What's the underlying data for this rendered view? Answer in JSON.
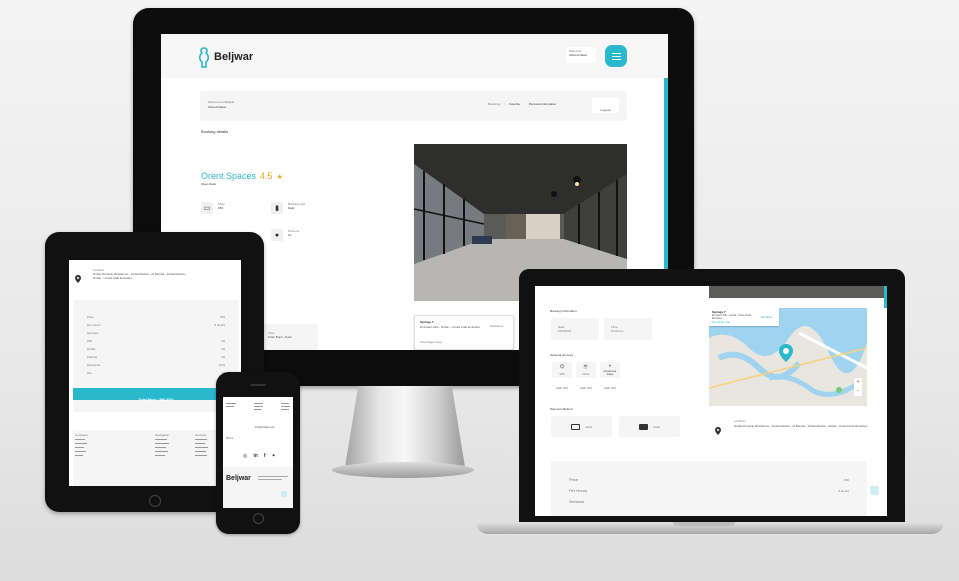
{
  "brand": {
    "name": "Beljwar"
  },
  "monitor": {
    "user_label": "Welcome",
    "user_name": "Ahmed Naser",
    "profile": {
      "welcome": "Welcome to Beljwar",
      "name": "Ahmed Naser"
    },
    "nav": [
      "Bookings",
      "Favorite",
      "Personal information"
    ],
    "logout": "Log out",
    "section_title": "Booking details",
    "space": {
      "name": "Orent Spaces",
      "rating": "4.5",
      "status": "Open Desk"
    },
    "features": [
      {
        "label": "Price",
        "value": "150"
      },
      {
        "label": "Booking type",
        "value": "Daily"
      },
      {
        "label": "Persons",
        "value": "10"
      }
    ],
    "time": {
      "label": "Time",
      "value": "From 8 am - 5 pm"
    },
    "location": {
      "title": "Springs 7",
      "address": "Emirates Hills - Dubai - United Arab Emirates",
      "directions": "Directions",
      "view_map": "View larger map"
    }
  },
  "tablet": {
    "location_label": "Location",
    "address": "Dubai Pinnacle Residence - Dubai Marina - Al Barsha - Dubai Marina - Dubai - United Arab Emirates",
    "summary": [
      {
        "label": "Price",
        "value": "150"
      },
      {
        "label": "Per Hours",
        "value": "5 Hours"
      },
      {
        "label": "Services",
        "value": ""
      },
      {
        "label": "Wifi",
        "value": "50"
      },
      {
        "label": "Drinks",
        "value": "50"
      },
      {
        "label": "Parking",
        "value": "50"
      },
      {
        "label": "Discounts",
        "value": "10%"
      },
      {
        "label": "Tax",
        "value": "10"
      }
    ],
    "total": "Total Price : 550 AED",
    "footer_cols": [
      "Company",
      "Navigation",
      "Services"
    ]
  },
  "laptop": {
    "booking_info": "Booking information",
    "date": {
      "label": "Date",
      "value": "10/4/2021"
    },
    "time": {
      "label": "Time",
      "value": "10:00 am"
    },
    "optional_services": "Optional services",
    "services": [
      {
        "name": "Wifi",
        "price": "AED 300"
      },
      {
        "name": "Drink",
        "price": "AED 300"
      },
      {
        "name": "Customer Care",
        "price": "AED 300"
      }
    ],
    "payment_method": "Payment Method",
    "payments": [
      "Card",
      "Cash"
    ],
    "map": {
      "title": "Springs 7",
      "address": "Emirates Hills - Dubai - United Arab Emirates",
      "directions": "Directions",
      "view_map": "View larger map"
    },
    "location": {
      "label": "Location",
      "address": "Dubai Pinnacle Residence - Dubai Marina - Al Barsha - Dubai Marina - Dubai - United Arab Emirates"
    },
    "summary": [
      {
        "label": "Price",
        "value": "150"
      },
      {
        "label": "Per Hours",
        "value": "5 Hours"
      },
      {
        "label": "Services",
        "value": ""
      }
    ]
  },
  "phone": {
    "footer_brand": "Beljwar",
    "email": "info@beljwar.com",
    "phone_label": "Phone",
    "social": [
      "instagram-icon",
      "linkedin-icon",
      "facebook-icon",
      "twitter-icon"
    ]
  },
  "colors": {
    "accent": "#2bb8cc",
    "star": "#f5a623"
  }
}
